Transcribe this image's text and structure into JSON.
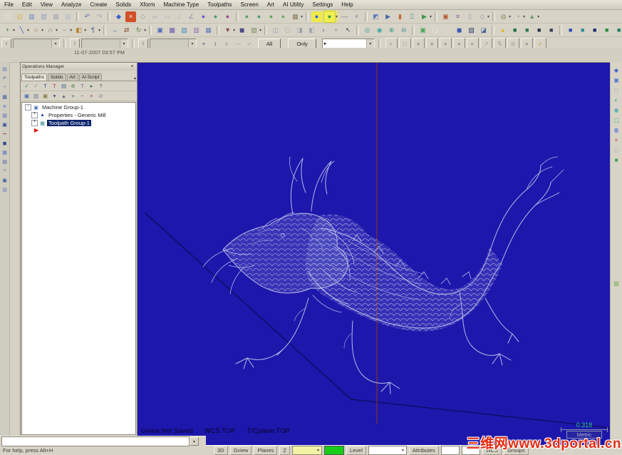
{
  "timestamp": "11-07-2007 03:57 PM",
  "glyphs": {
    "dropdown": "▾",
    "spinner": "↕",
    "arrow_right": "▸",
    "close": "×",
    "pin": "▴",
    "insert_arrow": "▶"
  },
  "menu": {
    "items": [
      "File",
      "Edit",
      "View",
      "Analyze",
      "Create",
      "Solids",
      "Xform",
      "Machine Type",
      "Toolpaths",
      "Screen",
      "Art",
      "AI Utility",
      "Settings",
      "Help"
    ]
  },
  "toolbars": {
    "row1": [
      {
        "n": "new-file",
        "g": "▢",
        "c": "#ece8dc"
      },
      {
        "n": "open-file",
        "g": "▤",
        "c": "#d8b868"
      },
      {
        "n": "save",
        "g": "▥",
        "c": "#6a80c4"
      },
      {
        "n": "file-merge",
        "g": "▧",
        "c": "#8ea0c0"
      },
      {
        "n": "print",
        "g": "▦",
        "c": "#a2aab4"
      },
      {
        "n": "print-preview",
        "g": "▩",
        "c": "#b8c0cc"
      },
      {
        "n": "undo",
        "g": "↶",
        "c": "#4a66b4",
        "sep": 1
      },
      {
        "n": "redo",
        "g": "↷",
        "c": "#9aa4b2"
      },
      {
        "n": "analyze-position",
        "g": "◆",
        "c": "#3a5cc8",
        "sep": 1
      },
      {
        "n": "delete-entities",
        "g": "×",
        "c": "#ffffff",
        "bg": "#d05028"
      },
      {
        "n": "undelete",
        "g": "◇",
        "c": "#8a94a8"
      },
      {
        "n": "analyze-distance",
        "g": "▱",
        "c": "#98a2b4"
      },
      {
        "n": "analyze-area",
        "g": "▭",
        "c": "#a8b0be"
      },
      {
        "n": "analyze-dynamic",
        "g": "▯",
        "c": "#b2b8c4"
      },
      {
        "n": "analyze-angle",
        "g": "∠",
        "c": "#8890a4"
      },
      {
        "n": "analyze-chain",
        "g": "●",
        "c": "#6a5ac8"
      },
      {
        "n": "analyze-contour",
        "g": "●",
        "c": "#4a9868"
      },
      {
        "n": "analyze-surface",
        "g": "●",
        "c": "#9a4a98"
      },
      {
        "n": "verify-1",
        "g": "●",
        "c": "#54a464",
        "sep": 1
      },
      {
        "n": "verify-2",
        "g": "●",
        "c": "#4a9a78"
      },
      {
        "n": "verify-3",
        "g": "●",
        "c": "#5aaa58"
      },
      {
        "n": "verify-4",
        "g": "●",
        "c": "#6ab068"
      },
      {
        "n": "screen-grid",
        "g": "▦",
        "c": "#8a7a58",
        "dd": 1
      },
      {
        "n": "ai-run-blue",
        "g": "●",
        "c": "#2a5ad8",
        "bg": "#eee84a",
        "sep": 1
      },
      {
        "n": "ai-run-green",
        "g": "●",
        "c": "#2a9a3a",
        "bg": "#eee84a",
        "hl": 1,
        "dd": 1
      },
      {
        "n": "line-style",
        "g": "—",
        "c": "#707a8c"
      },
      {
        "n": "point-style",
        "g": "+",
        "c": "#707a8c"
      },
      {
        "n": "gview-select",
        "g": "◩",
        "c": "#5a74b8",
        "sep": 1
      },
      {
        "n": "planes-select",
        "g": "▶",
        "c": "#4a64a8"
      },
      {
        "n": "z-depth-toggle",
        "g": "▮",
        "c": "#c06a3a"
      },
      {
        "n": "wcs-select",
        "g": "Ξ",
        "c": "#3a9a8a"
      },
      {
        "n": "run-addin",
        "g": "▶",
        "c": "#3a9a4a",
        "dd": 1
      },
      {
        "n": "grid-settings",
        "g": "▣",
        "c": "#b05a3a",
        "sep": 1
      },
      {
        "n": "viewsheets",
        "g": "≡",
        "c": "#8a5aa8"
      },
      {
        "n": "screen-blank",
        "g": "▯",
        "c": "#98a0b0"
      },
      {
        "n": "screen-combine",
        "g": "◇",
        "c": "#8a94a8",
        "dd": 1
      },
      {
        "n": "groups-manager",
        "g": "◍",
        "c": "#9a8a6a",
        "sep": 1,
        "dd": 1
      },
      {
        "n": "trap-entities",
        "g": "◔",
        "c": "#6a8a9a",
        "dd": 1
      },
      {
        "n": "level-manager",
        "g": "▲",
        "c": "#6a9a6a",
        "dd": 1
      }
    ],
    "row2": [
      {
        "n": "create-point",
        "g": "+",
        "c": "#3a8a3a",
        "dd": 1
      },
      {
        "n": "create-line",
        "g": "╲",
        "c": "#3a5ac8",
        "dd": 1
      },
      {
        "n": "create-arc",
        "g": "○",
        "c": "#c05a2a",
        "dd": 1
      },
      {
        "n": "create-fillet",
        "g": "∩",
        "c": "#8a6a4a",
        "dd": 1
      },
      {
        "n": "create-spline",
        "g": "~",
        "c": "#5a8ab4",
        "dd": 1
      },
      {
        "n": "create-surface",
        "g": "◧",
        "c": "#b4822a",
        "dd": 1
      },
      {
        "n": "create-drafting",
        "g": "¶",
        "c": "#5a6a8a",
        "dd": 1
      },
      {
        "n": "xform-translate",
        "g": "→",
        "c": "#3a6ab4",
        "sep": 1
      },
      {
        "n": "xform-mirror",
        "g": "⇄",
        "c": "#8a5a3a"
      },
      {
        "n": "xform-rotate",
        "g": "↻",
        "c": "#5a8a3a",
        "dd": 1
      },
      {
        "n": "solids-extrude",
        "g": "▣",
        "c": "#4a6ab4",
        "sep": 1
      },
      {
        "n": "solids-revolve",
        "g": "▩",
        "c": "#6a5ab4"
      },
      {
        "n": "solids-sweep",
        "g": "▨",
        "c": "#4a8ab4"
      },
      {
        "n": "solids-loft",
        "g": "▥",
        "c": "#8a6ab4"
      },
      {
        "n": "solids-fillet",
        "g": "▦",
        "c": "#5a7ab4"
      },
      {
        "n": "machine-mill",
        "g": "▼",
        "c": "#8a4a4a",
        "sep": 1,
        "dd": 1
      },
      {
        "n": "machine-lathe",
        "g": "◼",
        "c": "#4a4a8a"
      },
      {
        "n": "toolpath-contour",
        "g": "▧",
        "c": "#7a8a5a",
        "dd": 1
      },
      {
        "n": "view-iso",
        "g": "◫",
        "c": "#98a2b0",
        "sep": 1
      },
      {
        "n": "view-front",
        "g": "◻",
        "c": "#a2aab8"
      },
      {
        "n": "view-side",
        "g": "◨",
        "c": "#96a0ae"
      },
      {
        "n": "view-top",
        "g": "◧",
        "c": "#9aa4b2"
      },
      {
        "n": "view-rotate",
        "g": "◐",
        "c": "#8a94a4"
      },
      {
        "n": "view-pan",
        "g": "+",
        "c": "#8a94a4"
      },
      {
        "n": "cursor",
        "g": "↖",
        "c": "#3a4a6a"
      },
      {
        "n": "zoom-window",
        "g": "◎",
        "c": "#3a9a9a",
        "sep": 1
      },
      {
        "n": "zoom-target",
        "g": "◉",
        "c": "#3aa4a4"
      },
      {
        "n": "zoom-in",
        "g": "⊕",
        "c": "#3a9a8a"
      },
      {
        "n": "zoom-out",
        "g": "⊖",
        "c": "#3a8a9a"
      },
      {
        "n": "fit-screen",
        "g": "▣",
        "c": "#4aa45a",
        "sep": 1
      },
      {
        "n": "repaint",
        "g": "▢",
        "c": "#e8e8f0"
      },
      {
        "n": "shade-off",
        "g": "◻",
        "c": "#d8dce8"
      },
      {
        "n": "shade-on",
        "g": "◼",
        "c": "#3a5ab4"
      },
      {
        "n": "wireframe-display",
        "g": "▨",
        "c": "#2a3a6a"
      },
      {
        "n": "shade-settings",
        "g": "◪",
        "c": "#4a6a9a"
      },
      {
        "n": "material-yellow",
        "g": "▲",
        "c": "#d8b83a",
        "sep": 1
      },
      {
        "n": "material-green-1",
        "g": "■",
        "c": "#1a6a3a"
      },
      {
        "n": "material-green-2",
        "g": "■",
        "c": "#2a7a4a"
      },
      {
        "n": "material-dark-1",
        "g": "■",
        "c": "#24304a"
      },
      {
        "n": "material-dark-2",
        "g": "■",
        "c": "#343c54"
      },
      {
        "n": "level-blue",
        "g": "■",
        "c": "#2a4ab4",
        "sep": 1
      },
      {
        "n": "level-cyan",
        "g": "■",
        "c": "#2a8a9a"
      },
      {
        "n": "level-navy",
        "g": "■",
        "c": "#1a2a6a"
      },
      {
        "n": "level-green",
        "g": "■",
        "c": "#2a8a3a"
      },
      {
        "n": "level-teal",
        "g": "■",
        "c": "#1a7a6a"
      },
      {
        "n": "level-lime",
        "g": "■",
        "c": "#4aa43a",
        "hl2": 1
      },
      {
        "n": "level-rose",
        "g": "■",
        "c": "#a43a5a"
      },
      {
        "n": "attributes-check",
        "g": "✓",
        "c": "#8aa46a"
      }
    ],
    "row3_tools": [
      {
        "n": "xform-dynamic",
        "g": "+",
        "c": "#3a4a6a"
      },
      {
        "n": "stretch-select",
        "g": "↕",
        "c": "#3a4a6a"
      },
      {
        "n": "pick-reference",
        "g": "∧",
        "c": "#a09c8e"
      },
      {
        "n": "delta-select",
        "g": "—",
        "c": "#a09c8e"
      },
      {
        "n": "apply-check",
        "g": "✓",
        "c": "#a09c8e"
      }
    ],
    "all_label": "All",
    "only_label": "Only",
    "row3_round": [
      {
        "n": "select-last",
        "g": "◐",
        "d": 1
      },
      {
        "n": "select-window",
        "g": "◻",
        "d": 1
      },
      {
        "n": "select-polygon",
        "g": "●",
        "d": 1
      },
      {
        "n": "select-vector",
        "g": "●",
        "d": 1
      },
      {
        "n": "select-area",
        "g": "●",
        "d": 1
      },
      {
        "n": "select-single",
        "g": "●",
        "d": 1
      },
      {
        "n": "select-chain",
        "g": "▸",
        "d": 1
      },
      {
        "n": "select-jump",
        "g": "↗",
        "d": 1
      },
      {
        "n": "select-flip",
        "g": "⇅",
        "d": 1
      },
      {
        "n": "select-null",
        "g": "⊘",
        "d": 1
      },
      {
        "n": "select-sphere",
        "g": "●",
        "d": 1
      },
      {
        "n": "select-ok",
        "g": "✓",
        "d": 0,
        "c": "#b8a020"
      }
    ]
  },
  "left_dock": {
    "icons": [
      {
        "n": "dock-file-tab",
        "g": "▤",
        "c": "#5a7ab8"
      },
      {
        "n": "dock-undo",
        "g": "↶",
        "c": "#4a6ab4"
      },
      {
        "n": "dock-create",
        "g": "+",
        "c": "#7a92c4"
      },
      {
        "n": "dock-grid",
        "g": "▦",
        "c": "#3a5aa4"
      },
      {
        "n": "dock-analyze",
        "g": "◆",
        "c": "#8aa0cc"
      },
      {
        "n": "dock-view",
        "g": "▥",
        "c": "#4a66b0"
      },
      {
        "n": "dock-layers",
        "g": "▣",
        "c": "#2a4a94"
      },
      {
        "n": "dock-line",
        "g": "━",
        "c": "#a44a4a"
      },
      {
        "n": "dock-solid",
        "g": "◼",
        "c": "#34508c"
      },
      {
        "n": "dock-mesh",
        "g": "▦",
        "c": "#5a74b4"
      },
      {
        "n": "dock-sheet",
        "g": "▤",
        "c": "#44609c"
      },
      {
        "n": "dock-list",
        "g": "≡",
        "c": "#7a8cc0"
      },
      {
        "n": "dock-plane",
        "g": "▣",
        "c": "#3a569c"
      },
      {
        "n": "dock-level",
        "g": "▥",
        "c": "#6a82bc"
      }
    ]
  },
  "right_toolbar": {
    "icons": [
      {
        "n": "zoom-window-right",
        "g": "◆",
        "c": "#4a66c8"
      },
      {
        "n": "zoom-target-right",
        "g": "▣",
        "c": "#5878d0"
      },
      {
        "n": "zoom-dynamic",
        "g": "◻",
        "c": "#98a0a8"
      },
      {
        "n": "zoom-previous",
        "g": "◐",
        "c": "#3aa0a0"
      },
      {
        "n": "unzoom",
        "g": "◉",
        "c": "#48b0a8"
      },
      {
        "n": "fit-to-screen",
        "g": "▢",
        "c": "#58b868"
      },
      {
        "n": "dynamic-rotate",
        "g": "◍",
        "c": "#3868d8"
      },
      {
        "n": "clear-colors",
        "g": "×",
        "c": "#c04040"
      },
      {
        "n": "repaint-right",
        "g": "◻",
        "c": "#a0a8b0"
      },
      {
        "n": "shade-toggle",
        "g": "■",
        "c": "#38a048"
      },
      {
        "n": "art-apply",
        "g": "▨",
        "c": "#70a848"
      }
    ]
  },
  "ops_manager": {
    "title": "Operations Manager",
    "tabs": [
      {
        "label": "Toolpaths",
        "active": true
      },
      {
        "label": "Solids",
        "active": false
      },
      {
        "label": "Art",
        "active": false
      },
      {
        "label": "AI Script",
        "active": false
      }
    ],
    "toolbar1": [
      {
        "n": "select-all-operations",
        "g": "✓",
        "c": "#2a8a3a"
      },
      {
        "n": "select-operations",
        "g": "✓",
        "c": "#8a94a4"
      },
      {
        "n": "regen-selected",
        "g": "T",
        "c": "#2a44b4"
      },
      {
        "n": "regen-all",
        "g": "T",
        "c": "#a43a3a"
      },
      {
        "n": "toolpath-list",
        "g": "▤",
        "c": "#4a6a9a"
      },
      {
        "n": "verify-operations",
        "g": "⊕",
        "c": "#5a8a5a"
      },
      {
        "n": "lock-parameters",
        "g": "T",
        "c": "#7a6aa4"
      },
      {
        "n": "post-operations",
        "g": "▸",
        "c": "#3a7a3a"
      },
      {
        "n": "ops-help",
        "g": "?",
        "c": "#555555"
      }
    ],
    "toolbar2": [
      {
        "n": "toggle-toolpath-display",
        "g": "▣",
        "c": "#4a6ab4"
      },
      {
        "n": "blank-toolpath",
        "g": "▨",
        "c": "#6a7a9a"
      },
      {
        "n": "lock-toolpath",
        "g": "▣",
        "c": "#8a7a4a"
      },
      {
        "n": "move-insert-down",
        "g": "▾",
        "c": "#3a4a6a"
      },
      {
        "n": "move-insert-up",
        "g": "▴",
        "c": "#3a4a6a"
      },
      {
        "n": "expand-all",
        "g": "+",
        "c": "#3a6a4a"
      },
      {
        "n": "collapse-all",
        "g": "−",
        "c": "#6a4a3a"
      },
      {
        "n": "delete-operations",
        "g": "×",
        "c": "#a43a3a"
      },
      {
        "n": "disable-posting",
        "g": "⊘",
        "c": "#8a8a9a"
      }
    ],
    "tree": [
      {
        "label": "Machine Group-1",
        "level": 0,
        "expand": "−",
        "icon_glyph": "▣",
        "icon_color": "#4a6ab4",
        "selected": false
      },
      {
        "label": "Properties - Generic Mill",
        "level": 1,
        "expand": "+",
        "icon_glyph": "▲",
        "icon_color": "#2a44c4",
        "selected": false
      },
      {
        "label": "Toolpath Group-1",
        "level": 1,
        "expand": "+",
        "icon_glyph": "▦",
        "icon_color": "#2a8a8a",
        "selected": true
      }
    ]
  },
  "graphics": {
    "gview_status": "Gview:Not Saved",
    "wcs_status": "WCS:TOP",
    "tcplane_status": "T/Cplane:TOP",
    "scale_value": "0.318",
    "units_label": "Metric"
  },
  "statusbar": {
    "help_text": "For help, press Alt+H",
    "d3": "3D",
    "gview": "Gview",
    "planes": "Planes",
    "z": "Z",
    "level": "Level",
    "attributes": "Attributes",
    "wcs": "WCS",
    "groups": "Groups"
  },
  "watermark": {
    "text": "三维网www.3dportal.cn",
    "color": "#e32b13"
  },
  "colors": {
    "graphics_bg": "#1d17ac",
    "center_line_red": "#7a3030",
    "wireframe": "#ccd0ee",
    "selection_navy": "#0a246a",
    "scale_green": "#2cc08c",
    "chrome_gray": "#d7d3c6",
    "highlight_yellow": "#eee84a"
  }
}
